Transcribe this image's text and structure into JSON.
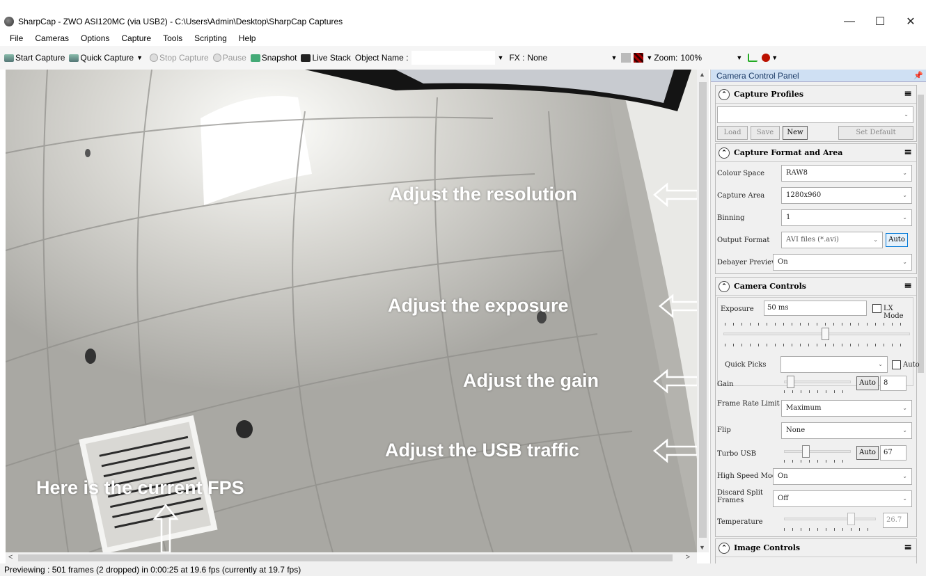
{
  "window": {
    "title": "SharpCap - ZWO ASI120MC (via USB2) - C:\\Users\\Admin\\Desktop\\SharpCap Captures",
    "minimize_glyph": "—",
    "maximize_glyph": "☐",
    "close_glyph": "✕"
  },
  "menu": [
    "File",
    "Cameras",
    "Options",
    "Capture",
    "Tools",
    "Scripting",
    "Help"
  ],
  "toolbar": {
    "start_capture": "Start Capture",
    "quick_capture": "Quick Capture",
    "stop_capture": "Stop Capture",
    "pause": "Pause",
    "snapshot": "Snapshot",
    "live_stack": "Live Stack",
    "object_name_label": "Object Name :",
    "object_name_value": "",
    "fx_label": "FX :",
    "fx_value": "None",
    "zoom_label": "Zoom:",
    "zoom_value": "100%"
  },
  "panel": {
    "title": "Camera Control Panel",
    "capture_profiles": {
      "title": "Capture Profiles",
      "profile_value": "",
      "load": "Load",
      "save": "Save",
      "new": "New",
      "set_default": "Set Default"
    },
    "capture_format": {
      "title": "Capture Format and Area",
      "colour_space_label": "Colour Space",
      "colour_space_value": "RAW8",
      "capture_area_label": "Capture Area",
      "capture_area_value": "1280x960",
      "binning_label": "Binning",
      "binning_value": "1",
      "output_format_label": "Output Format",
      "output_format_value": "AVI files (*.avi)",
      "output_auto": "Auto",
      "debayer_label": "Debayer Preview",
      "debayer_value": "On"
    },
    "camera_controls": {
      "title": "Camera Controls",
      "exposure_label": "Exposure",
      "exposure_value": "50 ms",
      "lx_mode_label": "LX Mode",
      "exposure_slider_level": 0.55,
      "quick_picks_label": "Quick Picks",
      "quick_picks_value": "",
      "quick_auto_label": "Auto",
      "gain_label": "Gain",
      "gain_auto": "Auto",
      "gain_value": "8",
      "gain_slider_level": 0.05,
      "frame_rate_label": "Frame Rate Limit",
      "frame_rate_value": "Maximum",
      "flip_label": "Flip",
      "flip_value": "None",
      "turbo_usb_label": "Turbo USB",
      "turbo_auto": "Auto",
      "turbo_value": "67",
      "turbo_slider_level": 0.3,
      "high_speed_label": "High Speed Mode",
      "high_speed_value": "On",
      "discard_split_label": "Discard Split Frames",
      "discard_split_value": "Off",
      "temperature_label": "Temperature",
      "temperature_value": "26.7",
      "temperature_slider_level": 0.75
    },
    "image_controls": {
      "title": "Image Controls"
    }
  },
  "annotations": {
    "resolution": "Adjust the resolution",
    "exposure": "Adjust  the  exposure",
    "gain": "Adjust the gain",
    "usb": "Adjust the USB traffic",
    "fps": "Here is the current FPS"
  },
  "status": {
    "text": "Previewing : 501 frames (2 dropped) in 0:00:25 at 19.6 fps  (currently at 19.7 fps)"
  }
}
